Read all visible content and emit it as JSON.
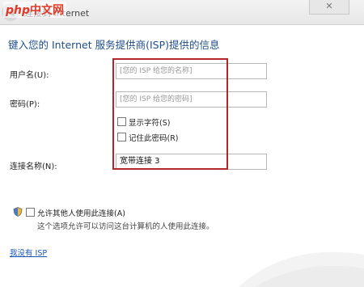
{
  "window": {
    "title": "连接到 Internet",
    "close_label": "✕",
    "back_icon": "back-arrow-icon"
  },
  "watermark": {
    "brand": "php",
    "text": "中文网"
  },
  "page": {
    "heading": "键入您的 Internet 服务提供商(ISP)提供的信息"
  },
  "form": {
    "username": {
      "label": "用户名(U):",
      "placeholder": "[您的 ISP 给您的名称]"
    },
    "password": {
      "label": "密码(P):",
      "placeholder": "[您的 ISP 给您的密码]"
    },
    "show_chars": {
      "label": "显示字符(S)",
      "checked": false
    },
    "remember_pw": {
      "label": "记住此密码(R)",
      "checked": false
    },
    "connection_name": {
      "label": "连接名称(N):",
      "value": "宽带连接 3"
    }
  },
  "sharing": {
    "checkbox_label": "允许其他人使用此连接(A)",
    "checked": false,
    "description": "这个选项允许可以访问这台计算机的人使用此连接。"
  },
  "footer": {
    "no_isp_link": "我没有 ISP"
  },
  "colors": {
    "heading": "#1e4e8c",
    "highlight": "#b3262a",
    "link": "#1a56b8"
  }
}
